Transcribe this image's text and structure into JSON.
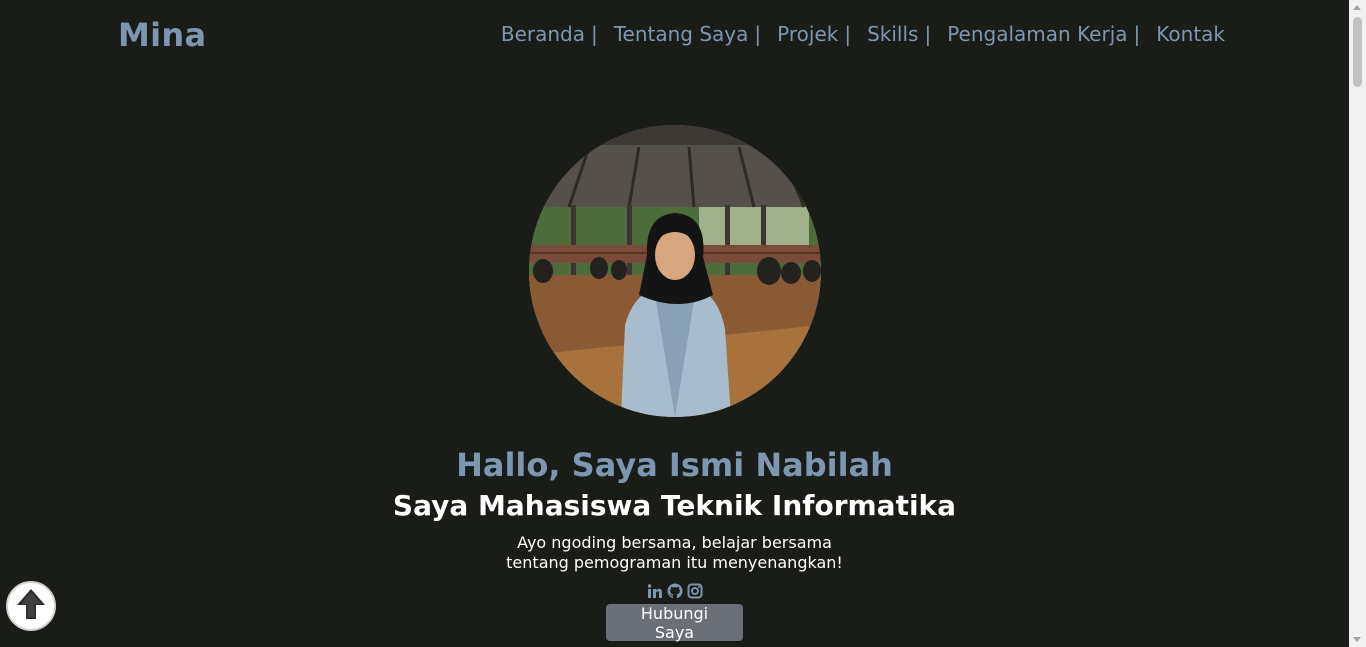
{
  "nav": {
    "logo": "Mina",
    "items": [
      {
        "label": "Beranda",
        "sep": "|"
      },
      {
        "label": "Tentang Saya",
        "sep": "|"
      },
      {
        "label": "Projek",
        "sep": "|"
      },
      {
        "label": "Skills",
        "sep": "|"
      },
      {
        "label": "Pengalaman Kerja",
        "sep": "|"
      },
      {
        "label": "Kontak",
        "sep": ""
      }
    ]
  },
  "hero": {
    "greeting": "Hallo, Saya Ismi Nabilah",
    "subtitle": "Saya Mahasiswa Teknik Informatika",
    "tagline": "Ayo ngoding bersama, belajar bersama tentang pemograman itu menyenangkan!",
    "socials": [
      "linkedin-icon",
      "github-icon",
      "instagram-icon"
    ],
    "cta_label": "Hubungi Saya"
  },
  "colors": {
    "background": "#1a1c17",
    "accent": "#7d96b2",
    "button": "#6b6f78"
  }
}
